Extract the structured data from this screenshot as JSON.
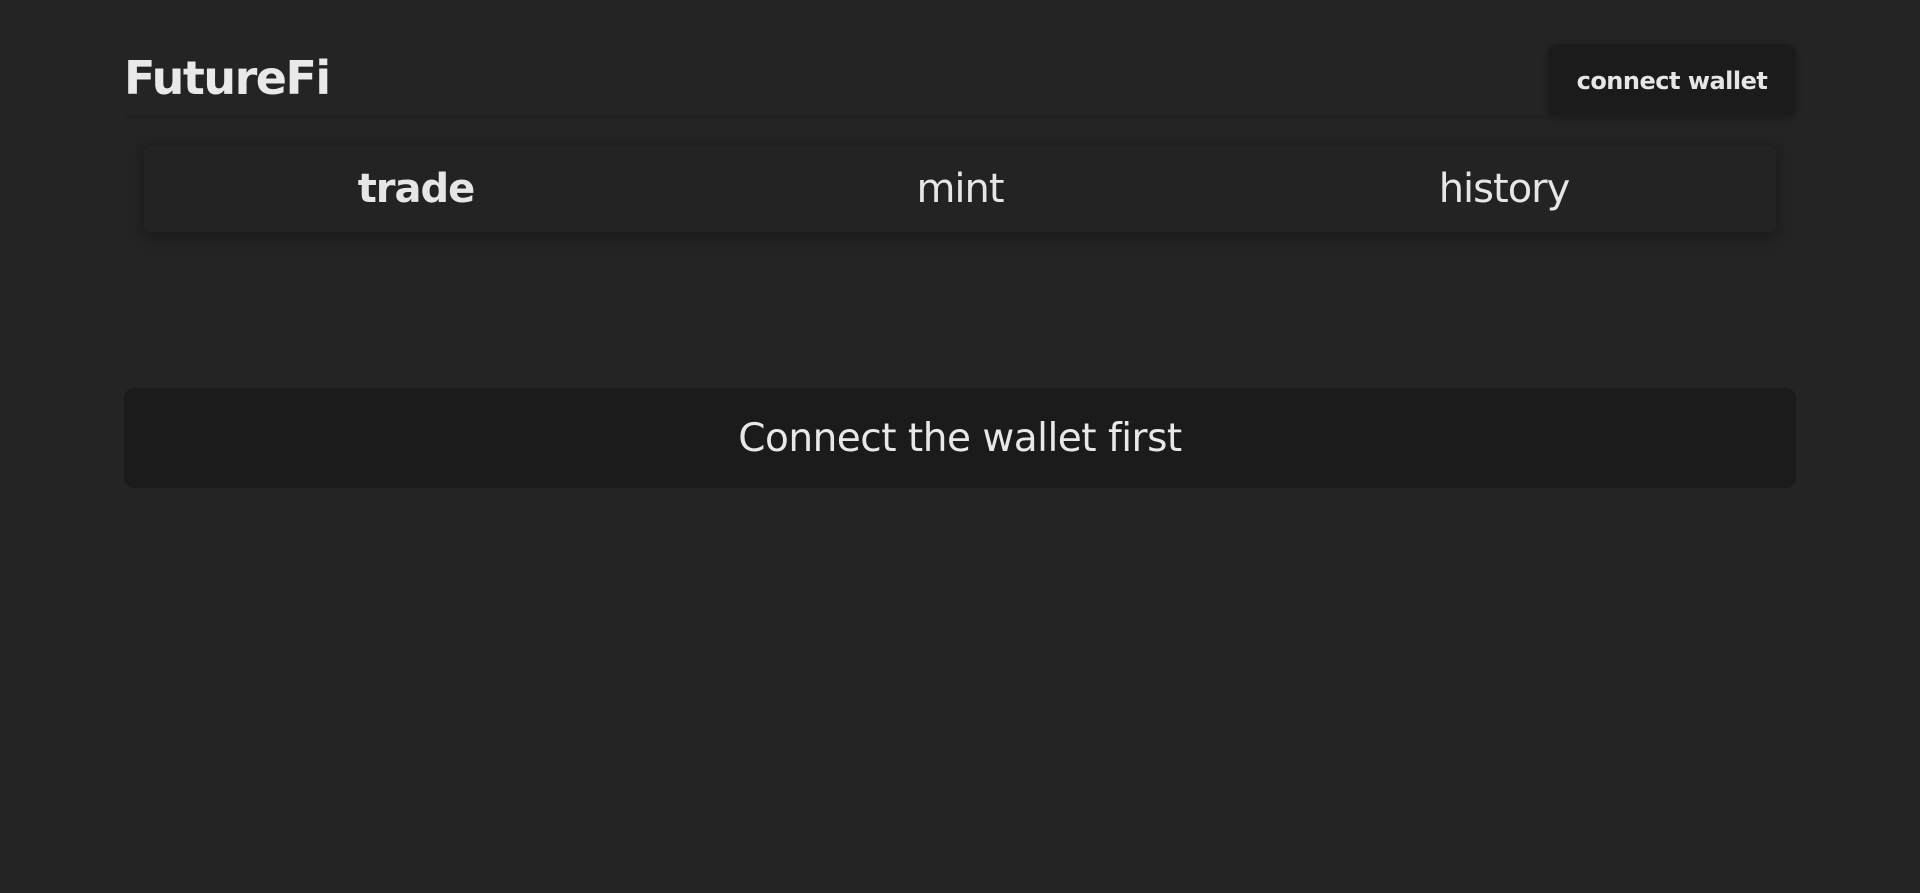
{
  "header": {
    "brand": "FutureFi",
    "connect_label": "connect wallet"
  },
  "tabs": [
    {
      "label": "trade",
      "active": true
    },
    {
      "label": "mint",
      "active": false
    },
    {
      "label": "history",
      "active": false
    }
  ],
  "main": {
    "notice": "Connect the wallet first"
  },
  "colors": {
    "background": "#242424",
    "panel": "#1b1b1b",
    "text": "#e8e8e8"
  }
}
